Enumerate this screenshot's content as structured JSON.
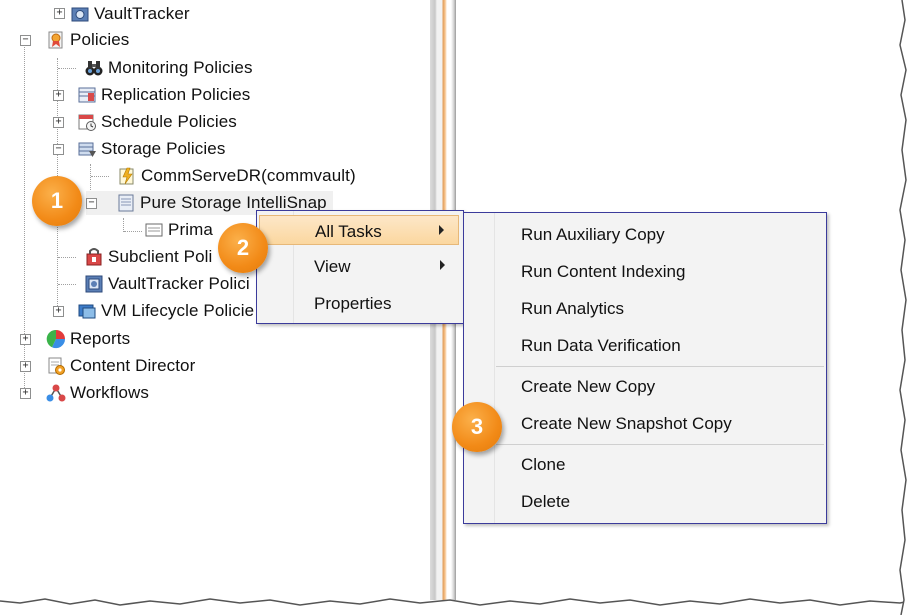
{
  "tree": {
    "items": [
      {
        "label": "VaultTracker",
        "icon": "vaulttracker-icon"
      },
      {
        "label": "Policies",
        "icon": "policies-icon"
      },
      {
        "label": "Monitoring Policies",
        "icon": "binoculars-icon"
      },
      {
        "label": "Replication Policies",
        "icon": "replication-icon"
      },
      {
        "label": "Schedule Policies",
        "icon": "calendar-clock-icon"
      },
      {
        "label": "Storage Policies",
        "icon": "storage-policy-icon"
      },
      {
        "label": "CommServeDR(commvault)",
        "icon": "dr-policy-icon"
      },
      {
        "label": "Pure Storage IntelliSnap",
        "icon": "storage-policy-doc-icon"
      },
      {
        "label": "Prima",
        "icon": "copy-icon"
      },
      {
        "label": "Subclient Poli",
        "icon": "subclient-policy-icon"
      },
      {
        "label": "VaultTracker Polici",
        "icon": "vaulttracker-policy-icon"
      },
      {
        "label": "VM Lifecycle Policie",
        "icon": "vm-lifecycle-icon"
      },
      {
        "label": "Reports",
        "icon": "reports-pie-icon"
      },
      {
        "label": "Content Director",
        "icon": "content-director-icon"
      },
      {
        "label": "Workflows",
        "icon": "workflows-icon"
      }
    ]
  },
  "context_menu": {
    "items": [
      {
        "label": "All Tasks",
        "submenu": true,
        "highlighted": true
      },
      {
        "label": "View",
        "submenu": true,
        "highlighted": false
      },
      {
        "label": "Properties",
        "submenu": false,
        "highlighted": false
      }
    ]
  },
  "submenu": {
    "groups": [
      [
        "Run Auxiliary Copy",
        "Run Content Indexing",
        "Run Analytics",
        "Run Data Verification"
      ],
      [
        "Create New Copy",
        "Create New Snapshot Copy"
      ],
      [
        "Clone",
        "Delete"
      ]
    ]
  },
  "callouts": [
    "1",
    "2",
    "3"
  ],
  "colors": {
    "callout_orange": "#f28a17",
    "menu_border": "#3b3b9b",
    "menu_highlight": "#fbd79f",
    "splitter_accent": "#e0a060"
  }
}
